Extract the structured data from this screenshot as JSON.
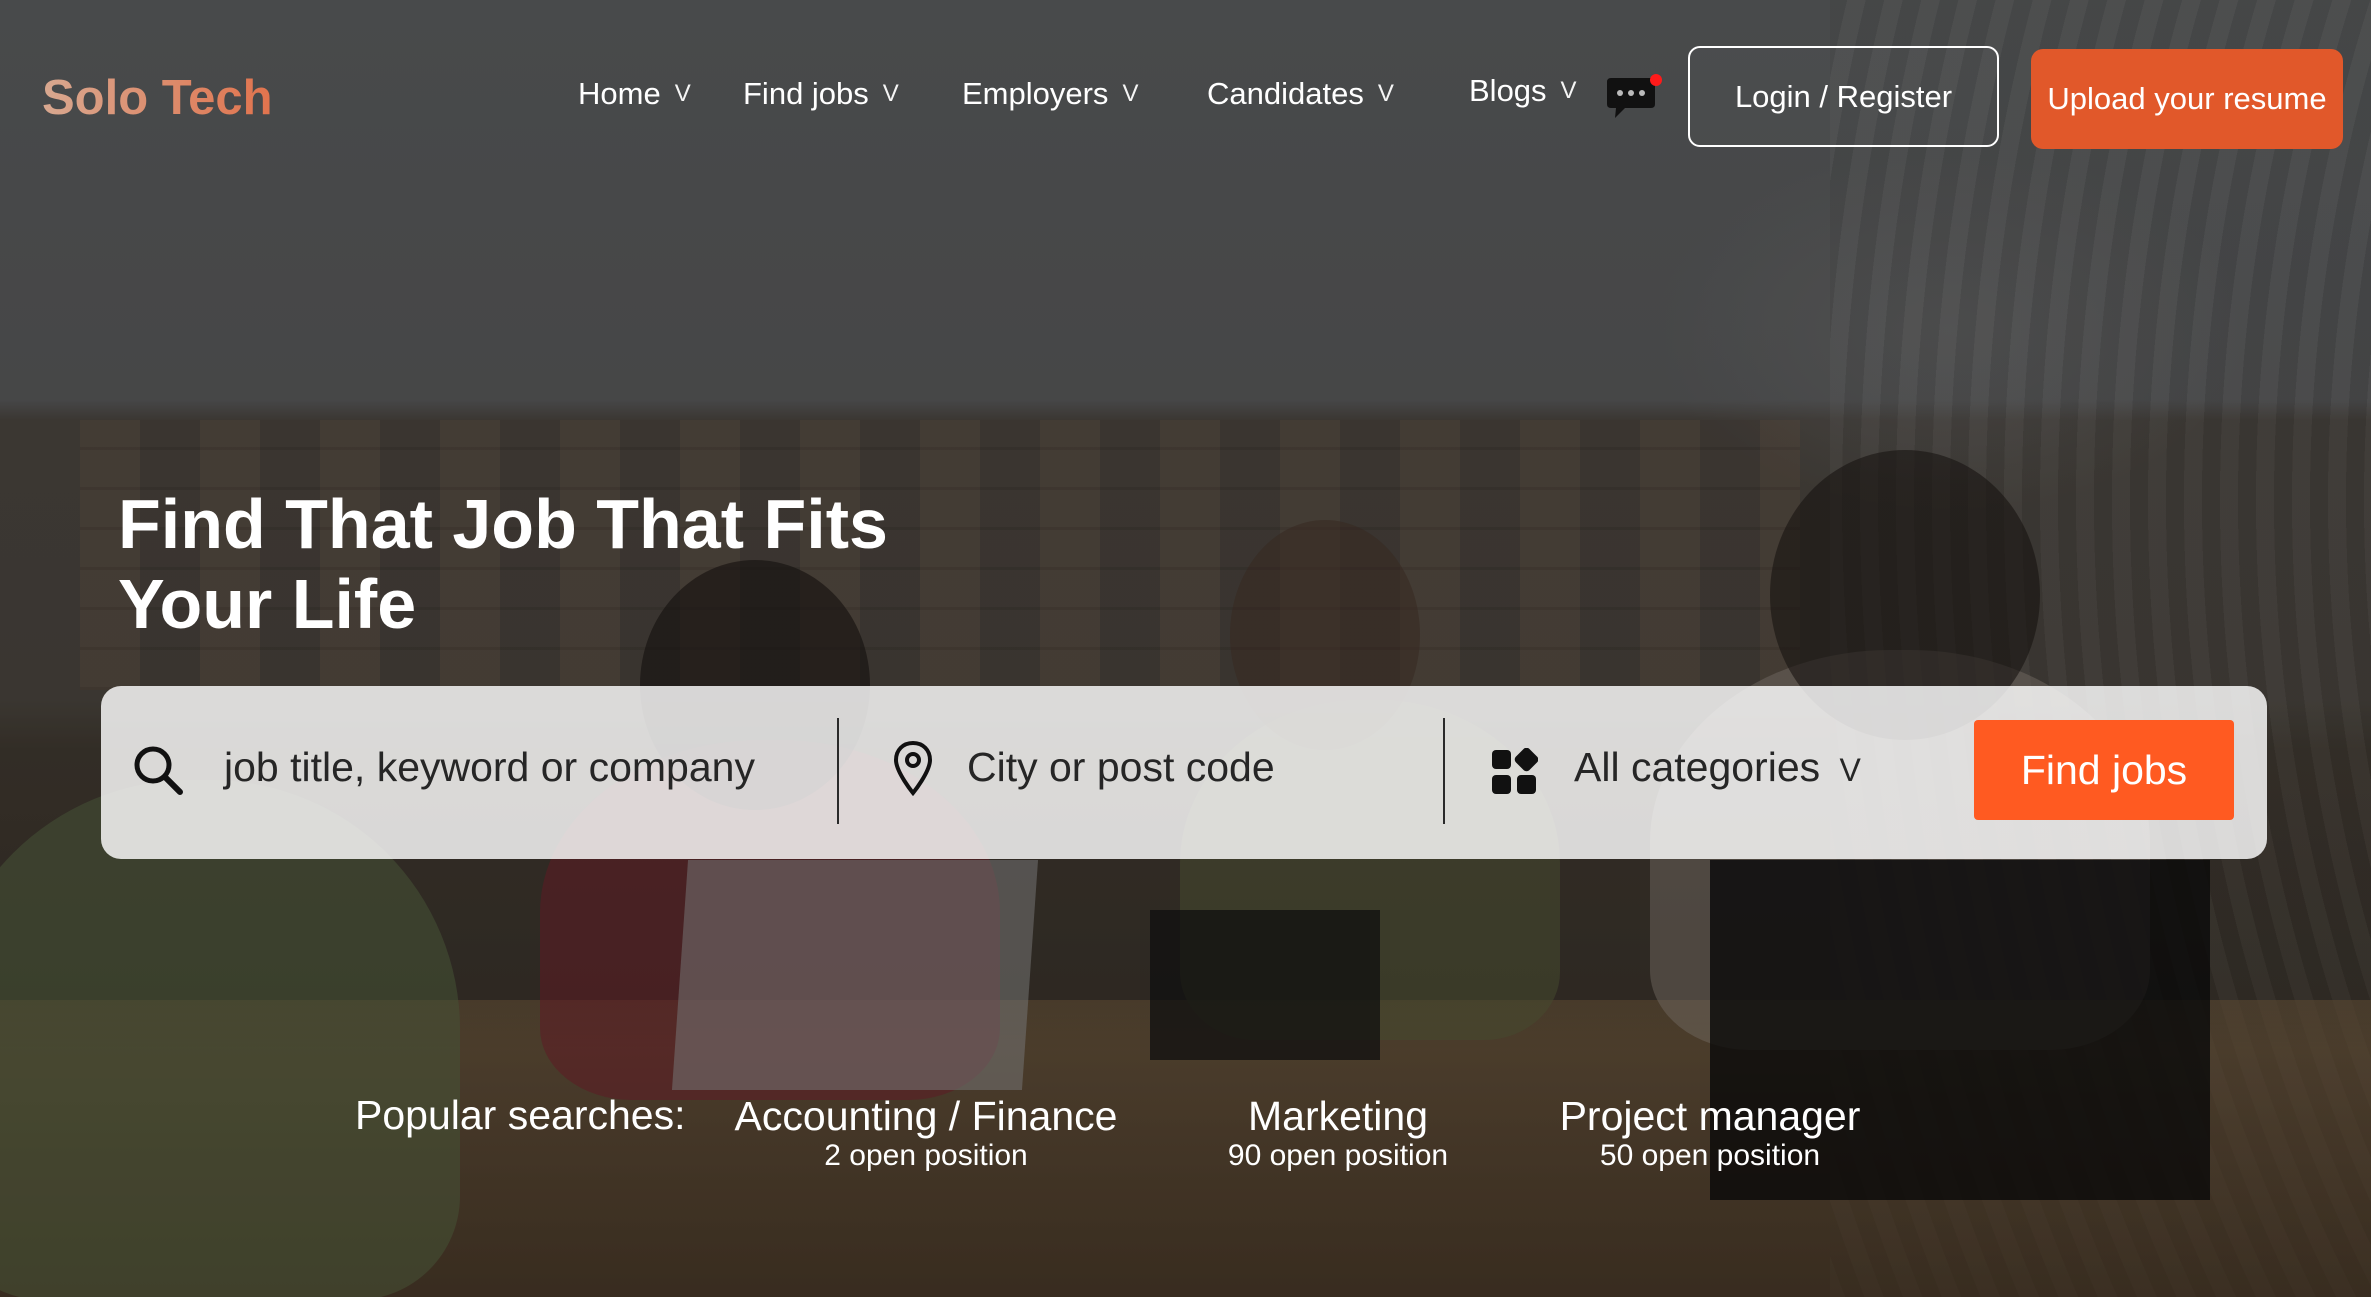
{
  "header": {
    "logo": "Solo Tech",
    "nav": [
      {
        "label": "Home",
        "chevron": "V"
      },
      {
        "label": "Find jobs",
        "chevron": "V"
      },
      {
        "label": "Employers",
        "chevron": "V"
      },
      {
        "label": "Candidates",
        "chevron": "V"
      },
      {
        "label": "Blogs",
        "chevron": "V"
      }
    ],
    "chat_icon": "chat-bubble-icon",
    "login_label": "Login / Register",
    "upload_label": "Upload your resume"
  },
  "hero": {
    "headline_line1": "Find That Job That Fits",
    "headline_line2": "Your Life"
  },
  "search": {
    "keyword_placeholder": "job title, keyword or company",
    "location_placeholder": "City or post code",
    "category_value": "All categories",
    "category_chevron": "V",
    "button_label": "Find jobs"
  },
  "popular": {
    "label": "Popular searches:",
    "items": [
      {
        "title": "Accounting / Finance",
        "count": "2 open position"
      },
      {
        "title": "Marketing",
        "count": "90 open position"
      },
      {
        "title": "Project manager",
        "count": "50 open position"
      }
    ]
  },
  "colors": {
    "accent": "#e1582a",
    "find_button": "#ff5a21",
    "notification_dot": "#ff1a1a"
  }
}
